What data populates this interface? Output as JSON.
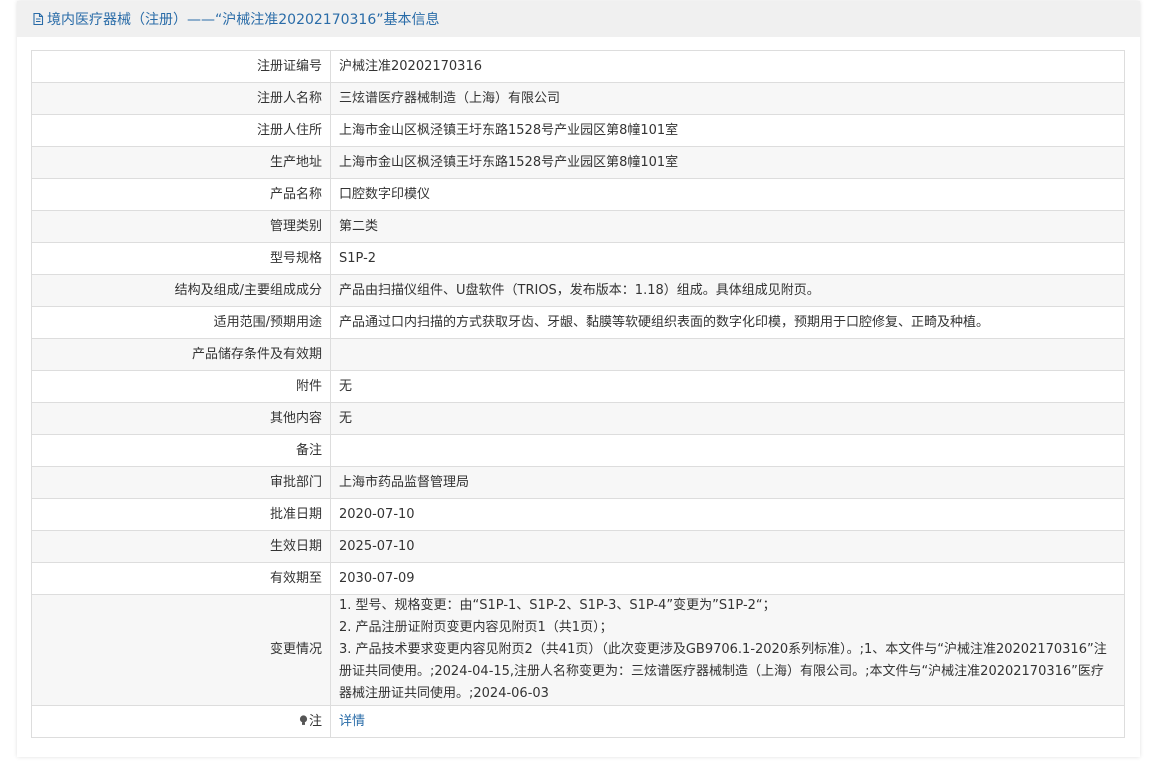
{
  "header": {
    "title": "境内医疗器械（注册）——“沪械注准20202170316”基本信息",
    "icon": "document-icon"
  },
  "rows": [
    {
      "label": "注册证编号",
      "value": "沪械注准20202170316"
    },
    {
      "label": "注册人名称",
      "value": "三炫谱医疗器械制造（上海）有限公司"
    },
    {
      "label": "注册人住所",
      "value": "上海市金山区枫泾镇王圩东路1528号产业园区第8幢101室"
    },
    {
      "label": "生产地址",
      "value": "上海市金山区枫泾镇王圩东路1528号产业园区第8幢101室"
    },
    {
      "label": "产品名称",
      "value": "口腔数字印模仪"
    },
    {
      "label": "管理类别",
      "value": "第二类"
    },
    {
      "label": "型号规格",
      "value": "S1P-2"
    },
    {
      "label": "结构及组成/主要组成成分",
      "value": "产品由扫描仪组件、U盘软件（TRIOS，发布版本：1.18）组成。具体组成见附页。"
    },
    {
      "label": "适用范围/预期用途",
      "value": "产品通过口内扫描的方式获取牙齿、牙龈、黏膜等软硬组织表面的数字化印模，预期用于口腔修复、正畸及种植。"
    },
    {
      "label": "产品储存条件及有效期",
      "value": ""
    },
    {
      "label": "附件",
      "value": "无"
    },
    {
      "label": "其他内容",
      "value": "无"
    },
    {
      "label": "备注",
      "value": ""
    },
    {
      "label": "审批部门",
      "value": "上海市药品监督管理局"
    },
    {
      "label": "批准日期",
      "value": "2020-07-10"
    },
    {
      "label": "生效日期",
      "value": "2025-07-10"
    },
    {
      "label": "有效期至",
      "value": "2030-07-09"
    }
  ],
  "change": {
    "label": "变更情况",
    "lines": [
      "1. 型号、规格变更：由“S1P-1、S1P-2、S1P-3、S1P-4”变更为”S1P-2“；",
      "2. 产品注册证附页变更内容见附页1（共1页）；",
      "3. 产品技术要求变更内容见附页2（共41页）（此次变更涉及GB9706.1-2020系列标准）。;1、本文件与“沪械注准20202170316”注册证共同使用。;2024-04-15,注册人名称变更为：三炫谱医疗器械制造（上海）有限公司。;本文件与“沪械注准20202170316”医疗器械注册证共同使用。;2024-06-03"
    ]
  },
  "note": {
    "icon": "lightbulb-icon",
    "label": "注",
    "link": "详情"
  }
}
